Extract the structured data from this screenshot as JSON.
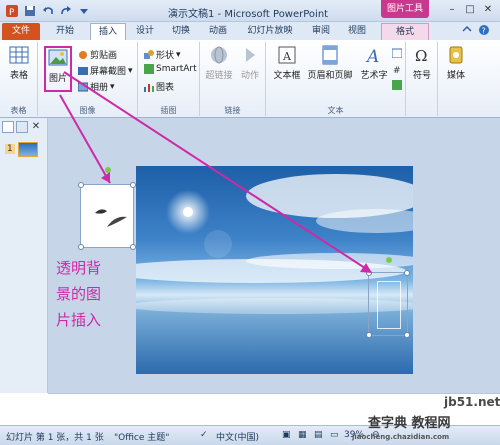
{
  "titlebar": {
    "title": "演示文稿1 - Microsoft PowerPoint",
    "picture_tools": "图片工具"
  },
  "tabs": [
    {
      "label": "文件"
    },
    {
      "label": "开始"
    },
    {
      "label": "插入"
    },
    {
      "label": "设计"
    },
    {
      "label": "切换"
    },
    {
      "label": "动画"
    },
    {
      "label": "幻灯片放映"
    },
    {
      "label": "审阅"
    },
    {
      "label": "视图"
    },
    {
      "label": "格式"
    }
  ],
  "ribbon": {
    "table_btn": "表格",
    "table_group": "表格",
    "picture_btn": "图片",
    "clipart_btn": "剪贴画",
    "screenshot_btn": "屏幕截图",
    "album_btn": "相册",
    "image_group": "图像",
    "shapes_btn": "形状",
    "smartart_btn": "SmartArt",
    "chart_btn": "图表",
    "illus_group": "插图",
    "hyperlink_btn": "超链接",
    "action_btn": "动作",
    "links_group": "链接",
    "textbox_btn": "文本框",
    "headerfooter_btn": "页眉和页脚",
    "wordart_btn": "艺术字",
    "text_group": "文本",
    "symbol_btn": "符号",
    "media_btn": "媒体"
  },
  "left_panel": {
    "slide_number": "1"
  },
  "annotation": "透明背景的图片插入",
  "statusbar": {
    "slide_info": "幻灯片 第 1 张，共 1 张",
    "theme": "\"Office 主题\"",
    "language": "中文(中国)",
    "zoom": "39%"
  },
  "watermark": {
    "site": "jb51.net",
    "brand": "查字典 教程网",
    "url": "jiaocheng.chazidian.com"
  },
  "colors": {
    "accent": "#cc2aa7",
    "file_tab": "#d2531f",
    "picture_tools": "#c8398e"
  }
}
